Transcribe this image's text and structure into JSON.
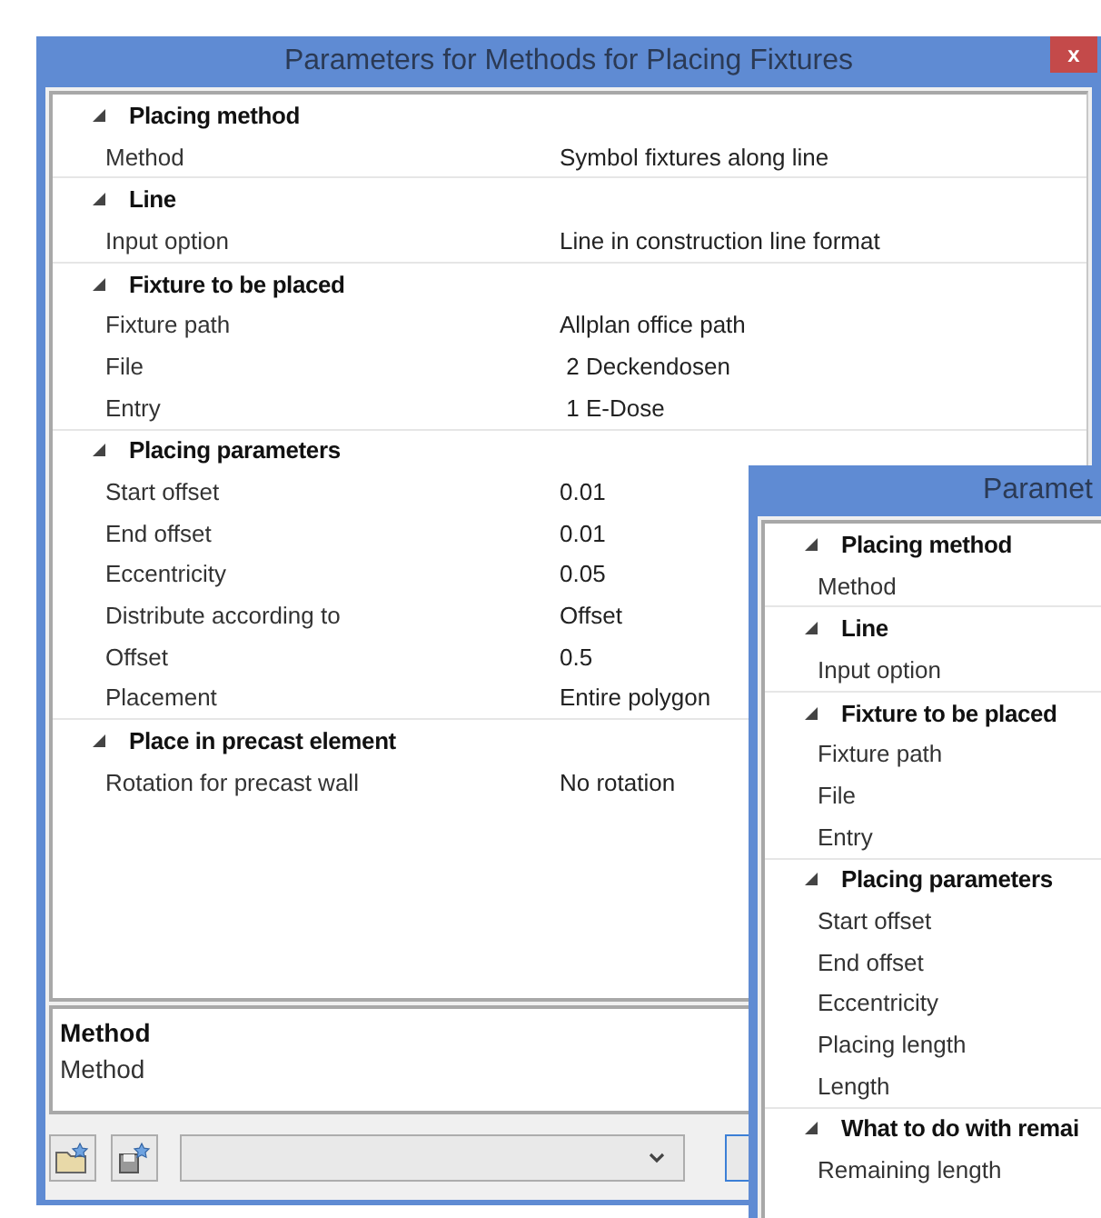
{
  "windows": [
    {
      "title": "Parameters for Methods for Placing Fixtures",
      "close": "x",
      "groups": [
        {
          "label": "Placing method",
          "expanded": true,
          "rows": [
            {
              "label": "Method",
              "value": "Symbol fixtures along line"
            }
          ]
        },
        {
          "label": "Line",
          "expanded": true,
          "rows": [
            {
              "label": "Input option",
              "value": "Line in construction line format"
            }
          ]
        },
        {
          "label": "Fixture to be placed",
          "expanded": true,
          "rows": [
            {
              "label": "Fixture path",
              "value": "Allplan office path"
            },
            {
              "label": "File",
              "value": " 2 Deckendosen"
            },
            {
              "label": "Entry",
              "value": " 1 E-Dose"
            }
          ]
        },
        {
          "label": "Placing parameters",
          "expanded": true,
          "rows": [
            {
              "label": "Start offset",
              "value": "0.01"
            },
            {
              "label": "End offset",
              "value": "0.01"
            },
            {
              "label": "Eccentricity",
              "value": "0.05"
            },
            {
              "label": "Distribute according to",
              "value": "Offset"
            },
            {
              "label": "Offset",
              "value": "0.5"
            },
            {
              "label": "Placement",
              "value": "Entire polygon"
            }
          ]
        },
        {
          "label": "Place in precast element",
          "expanded": true,
          "rows": [
            {
              "label": "Rotation for precast wall",
              "value": "No rotation"
            }
          ]
        }
      ],
      "description": {
        "title": "Method",
        "text": "Method"
      }
    },
    {
      "title": "Paramet",
      "groups": [
        {
          "label": "Placing method",
          "expanded": true,
          "rows": [
            {
              "label": "Method"
            }
          ]
        },
        {
          "label": "Line",
          "expanded": true,
          "rows": [
            {
              "label": "Input option"
            }
          ]
        },
        {
          "label": "Fixture to be placed",
          "expanded": true,
          "rows": [
            {
              "label": "Fixture path"
            },
            {
              "label": "File"
            },
            {
              "label": "Entry"
            }
          ]
        },
        {
          "label": "Placing parameters",
          "expanded": true,
          "rows": [
            {
              "label": "Start offset"
            },
            {
              "label": "End offset"
            },
            {
              "label": "Eccentricity"
            },
            {
              "label": "Placing length"
            },
            {
              "label": "Length"
            }
          ]
        },
        {
          "label": "What to do with remai",
          "expanded": true,
          "rows": [
            {
              "label": "Remaining length"
            }
          ]
        }
      ]
    }
  ]
}
